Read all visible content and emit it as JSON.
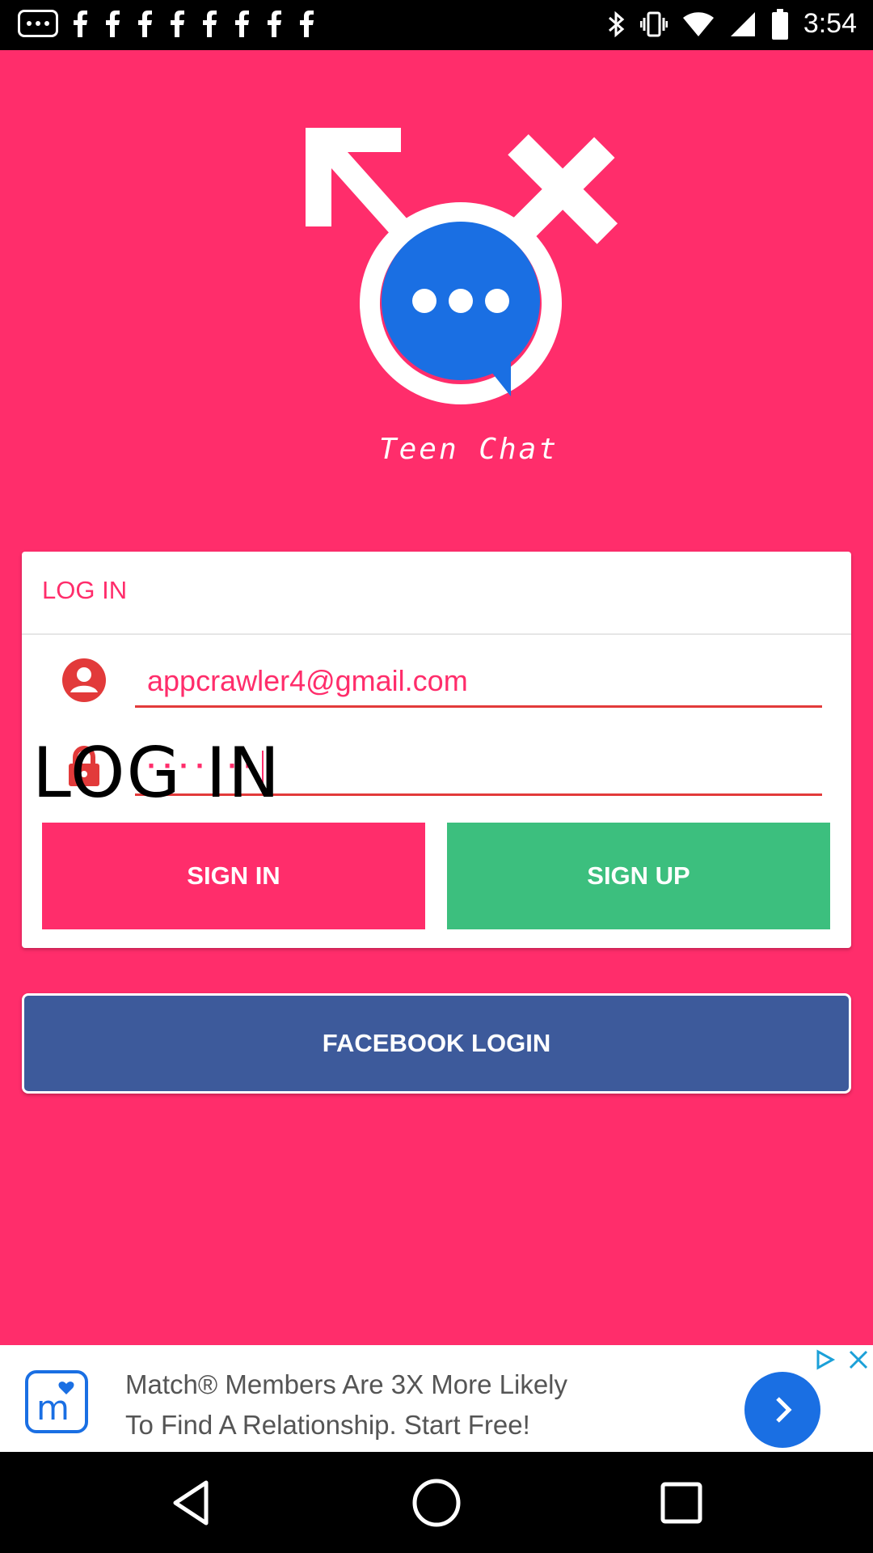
{
  "status_bar": {
    "time": "3:54",
    "icons": [
      "notification-dots-icon",
      "facebook-notification-icon",
      "bluetooth-icon",
      "vibrate-icon",
      "wifi-icon",
      "signal-icon",
      "battery-icon"
    ]
  },
  "app": {
    "logo_caption": "Teen Chat",
    "colors": {
      "primary": "#FF2D6B",
      "signup": "#3CBF7E",
      "facebook": "#3D5A9B",
      "logo_blue": "#1A6FE3"
    }
  },
  "login_card": {
    "title": "LOG IN",
    "email_value": "appcrawler4@gmail.com",
    "password_masked": "·······",
    "overlay_text": "LOG IN",
    "signin_label": "SIGN IN",
    "signup_label": "SIGN UP"
  },
  "facebook": {
    "label": "FACEBOOK LOGIN"
  },
  "ad": {
    "line1": "Match® Members Are 3X More Likely",
    "line2": "To Find A Relationship. Start Free!"
  }
}
